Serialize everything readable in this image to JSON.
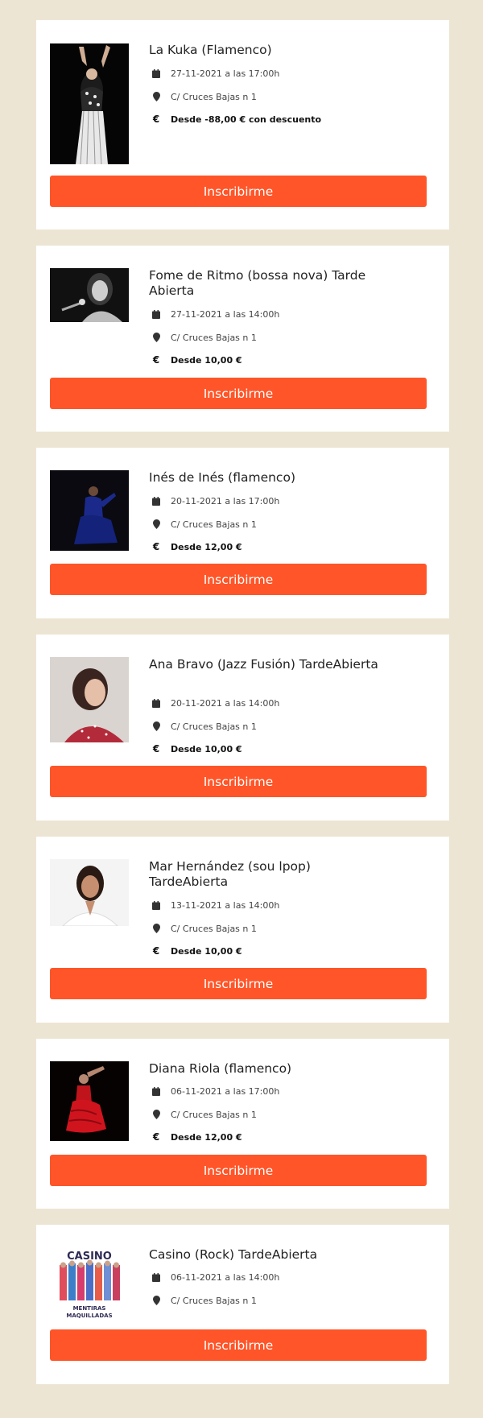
{
  "colors": {
    "background": "#ede5d3",
    "button": "#ff5528",
    "card": "#ffffff"
  },
  "events": [
    {
      "title": "La Kuka (Flamenco)",
      "date": "27-11-2021 a las 17:00h",
      "location": "C/ Cruces Bajas n 1",
      "price": "Desde -88,00 € con descuento",
      "button": "Inscribirme",
      "image": "flamenco-dancer-photo"
    },
    {
      "title": "Fome de Ritmo (bossa nova) Tarde Abierta",
      "date": "27-11-2021 a las 14:00h",
      "location": "C/ Cruces Bajas n 1",
      "price": "Desde 10,00 €",
      "button": "Inscribirme",
      "image": "singer-microphone-photo"
    },
    {
      "title": "Inés de Inés (flamenco)",
      "date": "20-11-2021 a las 17:00h",
      "location": "C/ Cruces Bajas n 1",
      "price": "Desde 12,00 €",
      "button": "Inscribirme",
      "image": "flamenco-blue-dress-photo"
    },
    {
      "title": "Ana Bravo (Jazz Fusión) TardeAbierta",
      "date": "20-11-2021 a las 14:00h",
      "location": "C/ Cruces Bajas n 1",
      "price": "Desde 10,00 €",
      "button": "Inscribirme",
      "image": "woman-portrait-photo"
    },
    {
      "title": "Mar Hernández (sou lpop) TardeAbierta",
      "date": "13-11-2021 a las 14:00h",
      "location": "C/ Cruces Bajas n 1",
      "price": "Desde 10,00 €",
      "button": "Inscribirme",
      "image": "woman-smiling-photo"
    },
    {
      "title": "Diana Riola (flamenco)",
      "date": "06-11-2021 a las 17:00h",
      "location": "C/ Cruces Bajas n 1",
      "price": "Desde 12,00 €",
      "button": "Inscribirme",
      "image": "flamenco-red-dress-photo"
    },
    {
      "title": "Casino (Rock) TardeAbierta",
      "date": "06-11-2021 a las 14:00h",
      "location": "C/ Cruces Bajas n 1",
      "price": null,
      "button": "Inscribirme",
      "image": "casino-band-poster",
      "poster_text": [
        "CASINO",
        "MENTIRAS",
        "MAQUILLADAS"
      ]
    }
  ],
  "icons": {
    "date": "calendar-icon",
    "location": "map-pin-icon",
    "price": "euro-icon"
  },
  "euro_symbol": "€"
}
